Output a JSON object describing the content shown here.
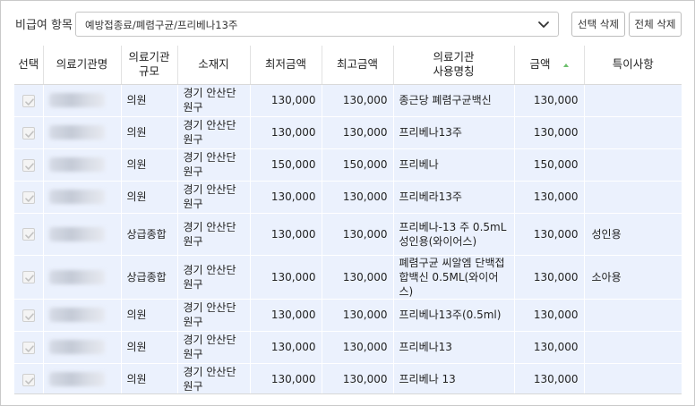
{
  "filter": {
    "label": "비급여 항목",
    "value": "예방접종료/폐렴구균/프리베나13주"
  },
  "buttons": {
    "delete_selected": "선택 삭제",
    "delete_all": "전체 삭제"
  },
  "columns": {
    "select": "선택",
    "facility_name": "의료기관명",
    "facility_scale_1": "의료기관",
    "facility_scale_2": "규모",
    "location": "소재지",
    "min_price": "최저금액",
    "max_price": "최고금액",
    "usage_name_1": "의료기관",
    "usage_name_2": "사용명칭",
    "price": "금액",
    "remarks": "특이사항"
  },
  "rows": [
    {
      "scale": "의원",
      "loc1": "경기 안산단",
      "loc2": "원구",
      "min": "130,000",
      "max": "130,000",
      "name": [
        "종근당 폐렴구균백신"
      ],
      "price": "130,000",
      "remark": ""
    },
    {
      "scale": "의원",
      "loc1": "경기 안산단",
      "loc2": "원구",
      "min": "130,000",
      "max": "130,000",
      "name": [
        "프리베나13주"
      ],
      "price": "130,000",
      "remark": ""
    },
    {
      "scale": "의원",
      "loc1": "경기 안산단",
      "loc2": "원구",
      "min": "150,000",
      "max": "150,000",
      "name": [
        "프리베나"
      ],
      "price": "150,000",
      "remark": ""
    },
    {
      "scale": "의원",
      "loc1": "경기 안산단",
      "loc2": "원구",
      "min": "130,000",
      "max": "130,000",
      "name": [
        "프리베라13주"
      ],
      "price": "130,000",
      "remark": ""
    },
    {
      "scale": "상급종합",
      "loc1": "경기 안산단",
      "loc2": "원구",
      "min": "130,000",
      "max": "130,000",
      "name": [
        "프리베나-13 주 0.5mL",
        "성인용(와이어스)"
      ],
      "price": "130,000",
      "remark": "성인용"
    },
    {
      "scale": "상급종합",
      "loc1": "경기 안산단",
      "loc2": "원구",
      "min": "130,000",
      "max": "130,000",
      "name": [
        "폐렴구균 씨알엠 단백접",
        "합백신 0.5ML(와이어",
        "스)"
      ],
      "price": "130,000",
      "remark": "소아용"
    },
    {
      "scale": "의원",
      "loc1": "경기 안산단",
      "loc2": "원구",
      "min": "130,000",
      "max": "130,000",
      "name": [
        "프리베나13주(0.5ml)"
      ],
      "price": "130,000",
      "remark": ""
    },
    {
      "scale": "의원",
      "loc1": "경기 안산단",
      "loc2": "원구",
      "min": "130,000",
      "max": "130,000",
      "name": [
        "프리베나13"
      ],
      "price": "130,000",
      "remark": ""
    },
    {
      "scale": "의원",
      "loc1": "경기 안산단",
      "loc2": "원구",
      "min": "130,000",
      "max": "130,000",
      "name": [
        "프리베나 13"
      ],
      "price": "130,000",
      "remark": ""
    }
  ],
  "icons": {
    "dropdown": "chevron-down-icon",
    "checkbox": "checkbox-checked-icon",
    "sort": "sort-ascending-icon"
  },
  "colors": {
    "row_background": "#ebf1fd",
    "sort_indicator": "#6cbf6c"
  }
}
